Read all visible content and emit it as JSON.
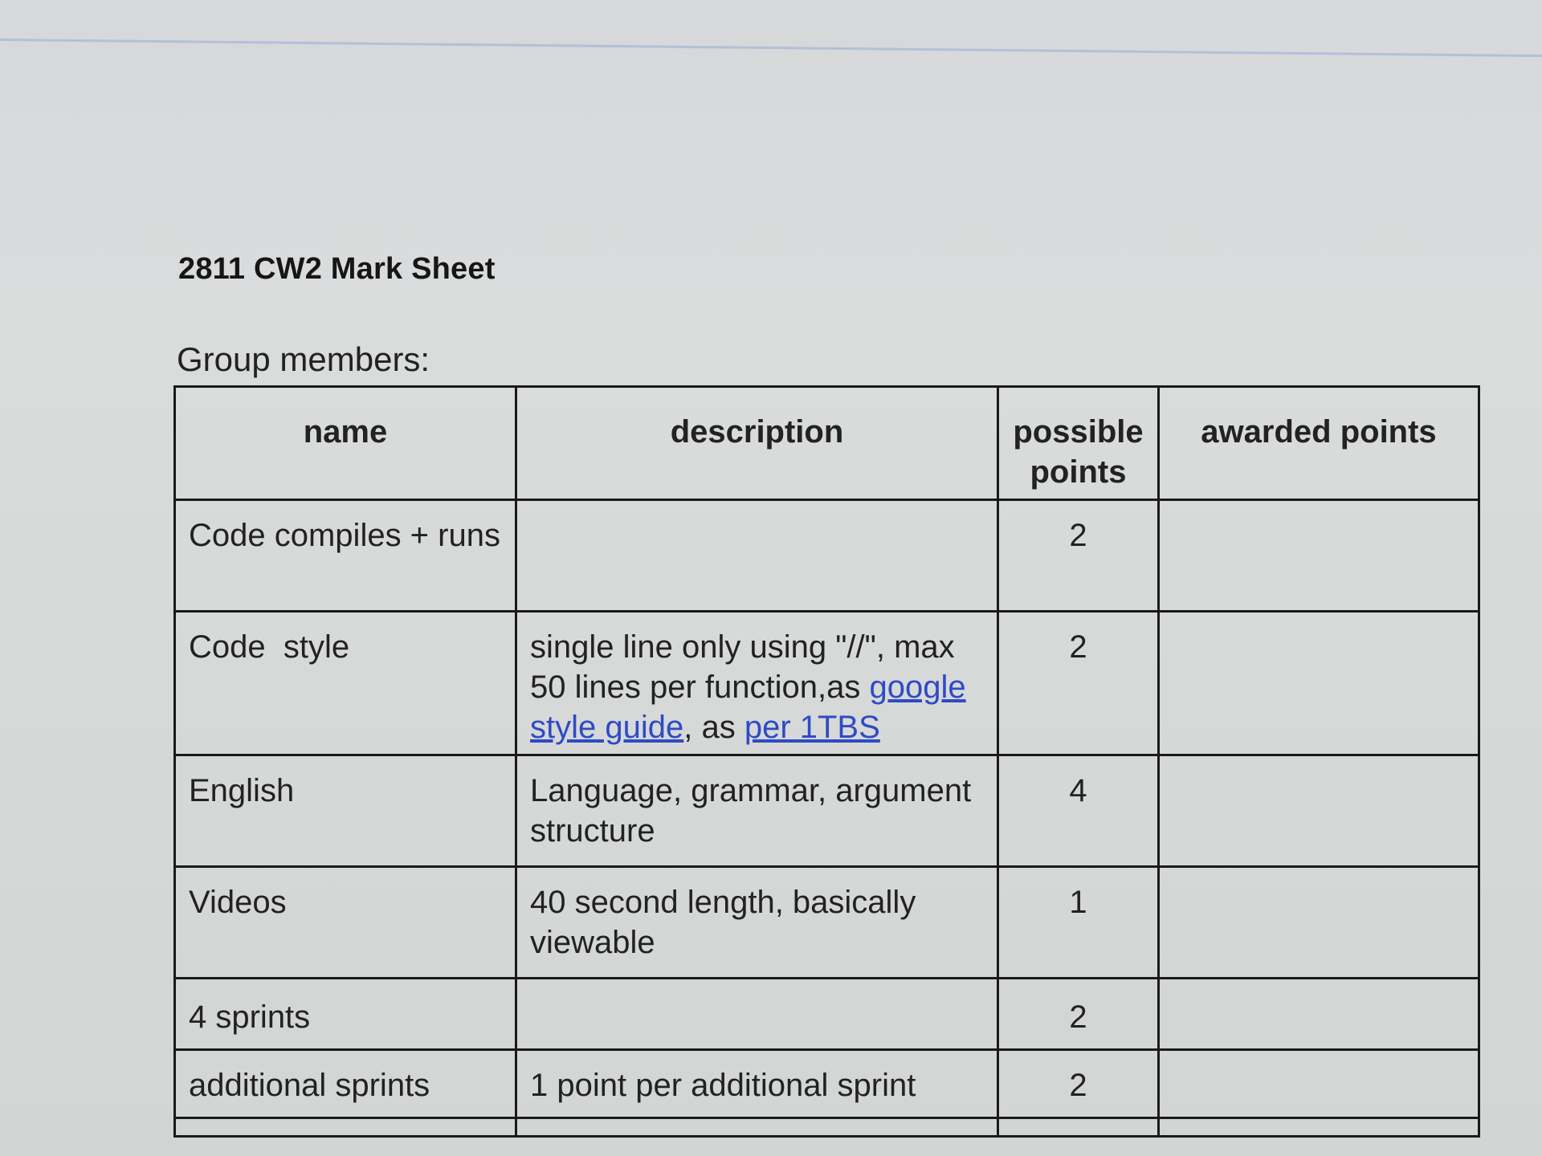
{
  "document": {
    "title": "2811 CW2 Mark Sheet",
    "group_label": "Group members:"
  },
  "table": {
    "headers": {
      "name": "name",
      "description": "description",
      "possible": "possible points",
      "awarded": "awarded points"
    },
    "rows": [
      {
        "name": "Code compiles + runs",
        "description": "",
        "possible": "2",
        "awarded": ""
      },
      {
        "name": "Code  style",
        "description_pre": "single line only using \"//\", max 50 lines per function,as ",
        "link1": "google style guide",
        "description_mid": ", as ",
        "link2": "per 1TBS",
        "possible": "2",
        "awarded": ""
      },
      {
        "name": "English",
        "description": "Language, grammar, argument structure",
        "possible": "4",
        "awarded": ""
      },
      {
        "name": "Videos",
        "description": "40 second length, basically viewable",
        "possible": "1",
        "awarded": ""
      },
      {
        "name": "4 sprints",
        "description": "",
        "possible": "2",
        "awarded": ""
      },
      {
        "name": "additional sprints",
        "description": "1 point per additional sprint",
        "possible": "2",
        "awarded": ""
      }
    ]
  }
}
